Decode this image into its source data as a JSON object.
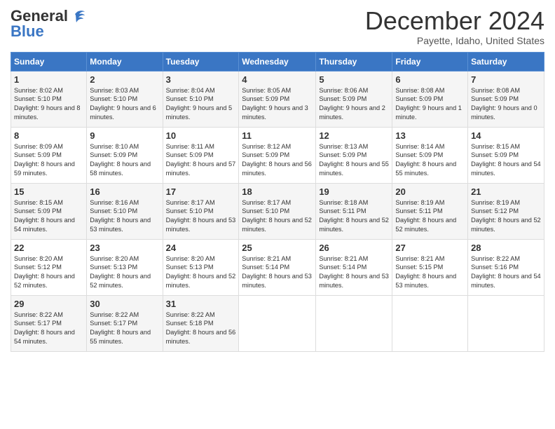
{
  "logo": {
    "line1": "General",
    "line2": "Blue"
  },
  "title": "December 2024",
  "location": "Payette, Idaho, United States",
  "days_header": [
    "Sunday",
    "Monday",
    "Tuesday",
    "Wednesday",
    "Thursday",
    "Friday",
    "Saturday"
  ],
  "weeks": [
    [
      {
        "day": "1",
        "sunrise": "8:02 AM",
        "sunset": "5:10 PM",
        "daylight": "9 hours and 8 minutes."
      },
      {
        "day": "2",
        "sunrise": "8:03 AM",
        "sunset": "5:10 PM",
        "daylight": "9 hours and 6 minutes."
      },
      {
        "day": "3",
        "sunrise": "8:04 AM",
        "sunset": "5:10 PM",
        "daylight": "9 hours and 5 minutes."
      },
      {
        "day": "4",
        "sunrise": "8:05 AM",
        "sunset": "5:09 PM",
        "daylight": "9 hours and 3 minutes."
      },
      {
        "day": "5",
        "sunrise": "8:06 AM",
        "sunset": "5:09 PM",
        "daylight": "9 hours and 2 minutes."
      },
      {
        "day": "6",
        "sunrise": "8:08 AM",
        "sunset": "5:09 PM",
        "daylight": "9 hours and 1 minute."
      },
      {
        "day": "7",
        "sunrise": "8:08 AM",
        "sunset": "5:09 PM",
        "daylight": "9 hours and 0 minutes."
      }
    ],
    [
      {
        "day": "8",
        "sunrise": "8:09 AM",
        "sunset": "5:09 PM",
        "daylight": "8 hours and 59 minutes."
      },
      {
        "day": "9",
        "sunrise": "8:10 AM",
        "sunset": "5:09 PM",
        "daylight": "8 hours and 58 minutes."
      },
      {
        "day": "10",
        "sunrise": "8:11 AM",
        "sunset": "5:09 PM",
        "daylight": "8 hours and 57 minutes."
      },
      {
        "day": "11",
        "sunrise": "8:12 AM",
        "sunset": "5:09 PM",
        "daylight": "8 hours and 56 minutes."
      },
      {
        "day": "12",
        "sunrise": "8:13 AM",
        "sunset": "5:09 PM",
        "daylight": "8 hours and 55 minutes."
      },
      {
        "day": "13",
        "sunrise": "8:14 AM",
        "sunset": "5:09 PM",
        "daylight": "8 hours and 55 minutes."
      },
      {
        "day": "14",
        "sunrise": "8:15 AM",
        "sunset": "5:09 PM",
        "daylight": "8 hours and 54 minutes."
      }
    ],
    [
      {
        "day": "15",
        "sunrise": "8:15 AM",
        "sunset": "5:09 PM",
        "daylight": "8 hours and 54 minutes."
      },
      {
        "day": "16",
        "sunrise": "8:16 AM",
        "sunset": "5:10 PM",
        "daylight": "8 hours and 53 minutes."
      },
      {
        "day": "17",
        "sunrise": "8:17 AM",
        "sunset": "5:10 PM",
        "daylight": "8 hours and 53 minutes."
      },
      {
        "day": "18",
        "sunrise": "8:17 AM",
        "sunset": "5:10 PM",
        "daylight": "8 hours and 52 minutes."
      },
      {
        "day": "19",
        "sunrise": "8:18 AM",
        "sunset": "5:11 PM",
        "daylight": "8 hours and 52 minutes."
      },
      {
        "day": "20",
        "sunrise": "8:19 AM",
        "sunset": "5:11 PM",
        "daylight": "8 hours and 52 minutes."
      },
      {
        "day": "21",
        "sunrise": "8:19 AM",
        "sunset": "5:12 PM",
        "daylight": "8 hours and 52 minutes."
      }
    ],
    [
      {
        "day": "22",
        "sunrise": "8:20 AM",
        "sunset": "5:12 PM",
        "daylight": "8 hours and 52 minutes."
      },
      {
        "day": "23",
        "sunrise": "8:20 AM",
        "sunset": "5:13 PM",
        "daylight": "8 hours and 52 minutes."
      },
      {
        "day": "24",
        "sunrise": "8:20 AM",
        "sunset": "5:13 PM",
        "daylight": "8 hours and 52 minutes."
      },
      {
        "day": "25",
        "sunrise": "8:21 AM",
        "sunset": "5:14 PM",
        "daylight": "8 hours and 53 minutes."
      },
      {
        "day": "26",
        "sunrise": "8:21 AM",
        "sunset": "5:14 PM",
        "daylight": "8 hours and 53 minutes."
      },
      {
        "day": "27",
        "sunrise": "8:21 AM",
        "sunset": "5:15 PM",
        "daylight": "8 hours and 53 minutes."
      },
      {
        "day": "28",
        "sunrise": "8:22 AM",
        "sunset": "5:16 PM",
        "daylight": "8 hours and 54 minutes."
      }
    ],
    [
      {
        "day": "29",
        "sunrise": "8:22 AM",
        "sunset": "5:17 PM",
        "daylight": "8 hours and 54 minutes."
      },
      {
        "day": "30",
        "sunrise": "8:22 AM",
        "sunset": "5:17 PM",
        "daylight": "8 hours and 55 minutes."
      },
      {
        "day": "31",
        "sunrise": "8:22 AM",
        "sunset": "5:18 PM",
        "daylight": "8 hours and 56 minutes."
      },
      null,
      null,
      null,
      null
    ]
  ]
}
